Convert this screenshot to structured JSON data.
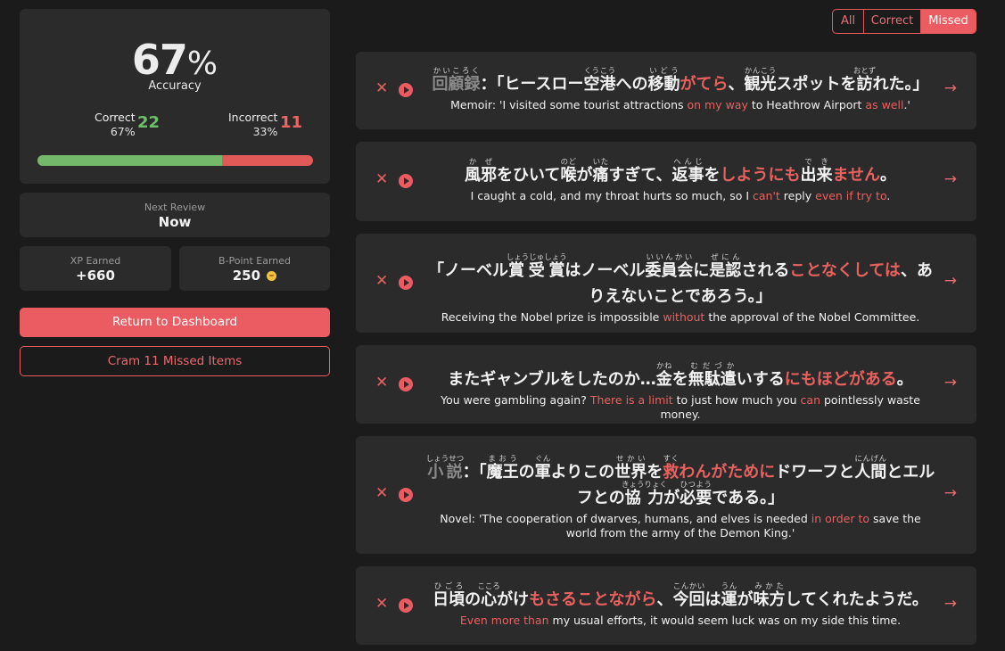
{
  "stats": {
    "accuracy_value": "67",
    "accuracy_symbol": "%",
    "accuracy_label": "Accuracy",
    "correct_label": "Correct",
    "correct_pct": "67%",
    "correct_count": "22",
    "incorrect_label": "Incorrect",
    "incorrect_pct": "33%",
    "incorrect_count": "11",
    "correct_fraction": 0.67,
    "colors": {
      "correct": "#6cc06a",
      "incorrect": "#eb6660",
      "accent": "#eb5c62"
    }
  },
  "next_review": {
    "label": "Next Review",
    "value": "Now"
  },
  "xp": {
    "label": "XP Earned",
    "value": "+660"
  },
  "bpoint": {
    "label": "B-Point Earned",
    "value": "250",
    "icon": "coin-icon"
  },
  "actions": {
    "return_label": "Return to Dashboard",
    "cram_label": "Cram 11 Missed Items"
  },
  "filters": {
    "all": "All",
    "correct": "Correct",
    "missed": "Missed",
    "selected": "Missed"
  },
  "items": [
    {
      "jp": [
        {
          "t": "回顧録",
          "r": "かいころく",
          "dim": true
        },
        {
          "t": "：「ヒースロー"
        },
        {
          "t": "空港",
          "r": "くうこう"
        },
        {
          "t": "への"
        },
        {
          "t": "移動",
          "r": "いどう"
        },
        {
          "t": "がてら",
          "hl": true
        },
        {
          "t": "、"
        },
        {
          "t": "観光",
          "r": "かんこう"
        },
        {
          "t": "スポットを"
        },
        {
          "t": "訪",
          "r": "おとず"
        },
        {
          "t": "れた。」"
        }
      ],
      "en": [
        {
          "t": "Memoir: 'I visited some tourist attractions "
        },
        {
          "t": "on my way",
          "hl": true
        },
        {
          "t": " to Heathrow Airport "
        },
        {
          "t": "as well",
          "hl": true
        },
        {
          "t": ".'"
        }
      ]
    },
    {
      "jp": [
        {
          "t": "風邪",
          "r": "かぜ"
        },
        {
          "t": "をひいて"
        },
        {
          "t": "喉",
          "r": "のど"
        },
        {
          "t": "が"
        },
        {
          "t": "痛",
          "r": "いた"
        },
        {
          "t": "すぎて、"
        },
        {
          "t": "返事",
          "r": "へんじ"
        },
        {
          "t": "を"
        },
        {
          "t": "しようにも",
          "hl": true
        },
        {
          "t": "出来",
          "r": "でき"
        },
        {
          "t": "ません",
          "hl": true
        },
        {
          "t": "。"
        }
      ],
      "en": [
        {
          "t": "I caught a cold, and my throat hurts so much, so I "
        },
        {
          "t": "can't",
          "hl": true
        },
        {
          "t": " reply "
        },
        {
          "t": "even if try to",
          "hl": true
        },
        {
          "t": "."
        }
      ]
    },
    {
      "jp": [
        {
          "t": "「ノーベル"
        },
        {
          "t": "賞受賞",
          "r": "しょうじゅしょう"
        },
        {
          "t": "はノーベル"
        },
        {
          "t": "委員会",
          "r": "いいんかい"
        },
        {
          "t": "に"
        },
        {
          "t": "是認",
          "r": "ぜにん"
        },
        {
          "t": "される"
        },
        {
          "t": "ことなくしては",
          "hl": true
        },
        {
          "t": "、ありえないことであろう。」"
        }
      ],
      "en": [
        {
          "t": "Receiving the Nobel prize is impossible "
        },
        {
          "t": "without",
          "hl": true
        },
        {
          "t": " the approval of the Nobel Committee."
        }
      ]
    },
    {
      "jp": [
        {
          "t": "またギャンブルをしたのか…"
        },
        {
          "t": "金",
          "r": "かね"
        },
        {
          "t": "を"
        },
        {
          "t": "無駄遣",
          "r": "むだづか"
        },
        {
          "t": "いする"
        },
        {
          "t": "にもほどがある",
          "hl": true
        },
        {
          "t": "。"
        }
      ],
      "en": [
        {
          "t": "You were gambling again? "
        },
        {
          "t": "There is a limit",
          "hl": true
        },
        {
          "t": " to just how much you "
        },
        {
          "t": "can",
          "hl": true
        },
        {
          "t": " pointlessly waste money."
        }
      ]
    },
    {
      "jp": [
        {
          "t": "小説",
          "r": "しょうせつ",
          "dim": true
        },
        {
          "t": "：「"
        },
        {
          "t": "魔王",
          "r": "まおう"
        },
        {
          "t": "の"
        },
        {
          "t": "軍",
          "r": "ぐん"
        },
        {
          "t": "よりこの"
        },
        {
          "t": "世界",
          "r": "せかい"
        },
        {
          "t": "を"
        },
        {
          "t": "救",
          "r": "すく",
          "hl": true
        },
        {
          "t": "わんがために",
          "hl": true
        },
        {
          "t": "ドワーフと"
        },
        {
          "t": "人間",
          "r": "にんげん"
        },
        {
          "t": "とエルフとの"
        },
        {
          "t": "協力",
          "r": "きょうりょく"
        },
        {
          "t": "が"
        },
        {
          "t": "必要",
          "r": "ひつよう"
        },
        {
          "t": "である。」"
        }
      ],
      "en": [
        {
          "t": "Novel: 'The cooperation of dwarves, humans, and elves is needed "
        },
        {
          "t": "in order to",
          "hl": true
        },
        {
          "t": " save the world from the army of the Demon King.'"
        }
      ]
    },
    {
      "jp": [
        {
          "t": "日頃",
          "r": "ひごろ"
        },
        {
          "t": "の"
        },
        {
          "t": "心",
          "r": "こころ"
        },
        {
          "t": "がけ"
        },
        {
          "t": "もさることながら",
          "hl": true
        },
        {
          "t": "、"
        },
        {
          "t": "今回",
          "r": "こんかい"
        },
        {
          "t": "は"
        },
        {
          "t": "運",
          "r": "うん"
        },
        {
          "t": "が"
        },
        {
          "t": "味方",
          "r": "みかた"
        },
        {
          "t": "してくれたようだ。"
        }
      ],
      "en": [
        {
          "t": "Even more than",
          "hl": true
        },
        {
          "t": " my usual efforts, it would seem luck was on my side this time."
        }
      ]
    }
  ],
  "icons": {
    "remove": "close-icon",
    "play": "play-icon",
    "open": "arrow-right-icon"
  },
  "glyphs": {
    "remove": "✕",
    "open": "→"
  }
}
